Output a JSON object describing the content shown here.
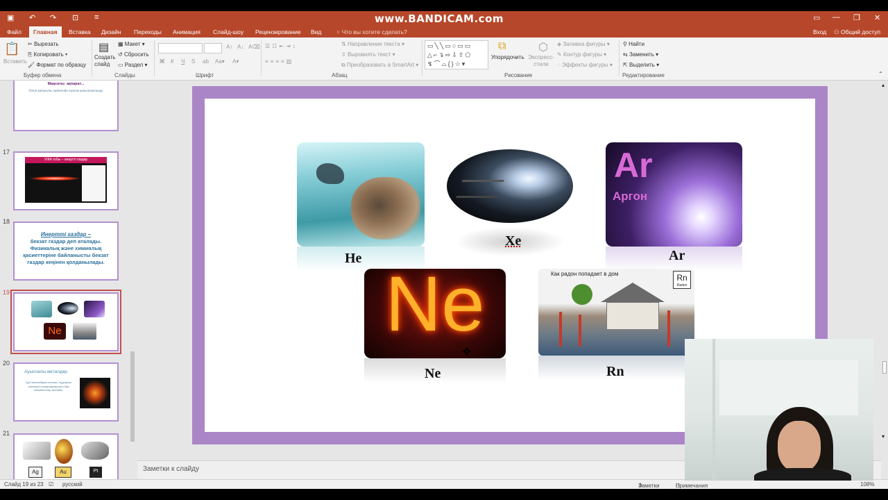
{
  "watermark": "www.BANDICAM.com",
  "title_bar": {
    "undo": "↶",
    "redo": "↷"
  },
  "menu": {
    "tabs": [
      "Файл",
      "Главная",
      "Вставка",
      "Дизайн",
      "Переходы",
      "Анимация",
      "Слайд-шоу",
      "Рецензирование",
      "Вид"
    ],
    "active_tab": "Главная",
    "tell_me": "Что вы хотите сделать?",
    "sign_in": "Вход",
    "share": "Общий доступ"
  },
  "ribbon": {
    "clipboard": {
      "paste": "Вставить",
      "cut": "Вырезать",
      "copy": "Копировать",
      "format_painter": "Формат по образцу",
      "group_label": "Буфер обмена"
    },
    "slides": {
      "new_slide": "Создать слайд",
      "layout": "Макет",
      "reset": "Сбросить",
      "section": "Раздел",
      "group_label": "Слайды"
    },
    "font": {
      "bold": "Ж",
      "italic": "К",
      "underline": "Ч",
      "strike": "S",
      "group_label": "Шрифт"
    },
    "paragraph": {
      "text_direction": "Направление текста",
      "align_text": "Выровнять текст",
      "smartart": "Преобразовать в SmartArt",
      "group_label": "Абзац"
    },
    "drawing": {
      "arrange": "Упорядочить",
      "quick_styles": "Экспресс-стили",
      "shape_fill": "Заливка фигуры",
      "shape_outline": "Контур фигуры",
      "shape_effects": "Эффекты фигуры",
      "group_label": "Рисование"
    },
    "editing": {
      "find": "Найти",
      "replace": "Заменить",
      "select": "Выделить",
      "group_label": "Редактирование"
    }
  },
  "thumbnails": [
    {
      "number": "",
      "title": "Мақсаты: ақпарат...",
      "text": "Тіліне қатысты жүйесінде түсінік қалыптастыру."
    },
    {
      "number": "17",
      "title": "VIIIA тобы – инертті газдар",
      "text": ""
    },
    {
      "number": "18",
      "title": "Инертті газдар –",
      "text": "бекзат газдар деп аталады. Физикалық және химиялық қасиеттеріне байланысты бекзат газдар кеңінен қолданылады."
    },
    {
      "number": "19",
      "title": "",
      "text": ""
    },
    {
      "number": "20",
      "title": "Ауыспалы металдар",
      "text": "Бұл металдарға атомы, тұрақты электрон конфигурациясы бар элементтер жатады."
    },
    {
      "number": "21",
      "title": "",
      "text": ""
    }
  ],
  "slide": {
    "labels": {
      "he": "He",
      "xe": "Xe",
      "ar": "Ar",
      "ne": "Ne",
      "rn": "Rn"
    },
    "ar_image_text": {
      "symbol": "Ar",
      "name": "Аргон"
    },
    "ne_image_text": "Ne",
    "rn_image_text": {
      "caption": "Как радон попадает в дом",
      "symbol": "Rn",
      "name": "Radon"
    }
  },
  "notes_placeholder": "Заметки к слайду",
  "status": {
    "slide_counter": "Слайд 19 из 23",
    "language": "русский",
    "notes": "Заметки",
    "comments": "Примечания",
    "zoom": "108%"
  },
  "colors": {
    "accent": "#b7472a",
    "slide_frame": "#ab86c6",
    "thumb_border": "#b48fcf"
  }
}
